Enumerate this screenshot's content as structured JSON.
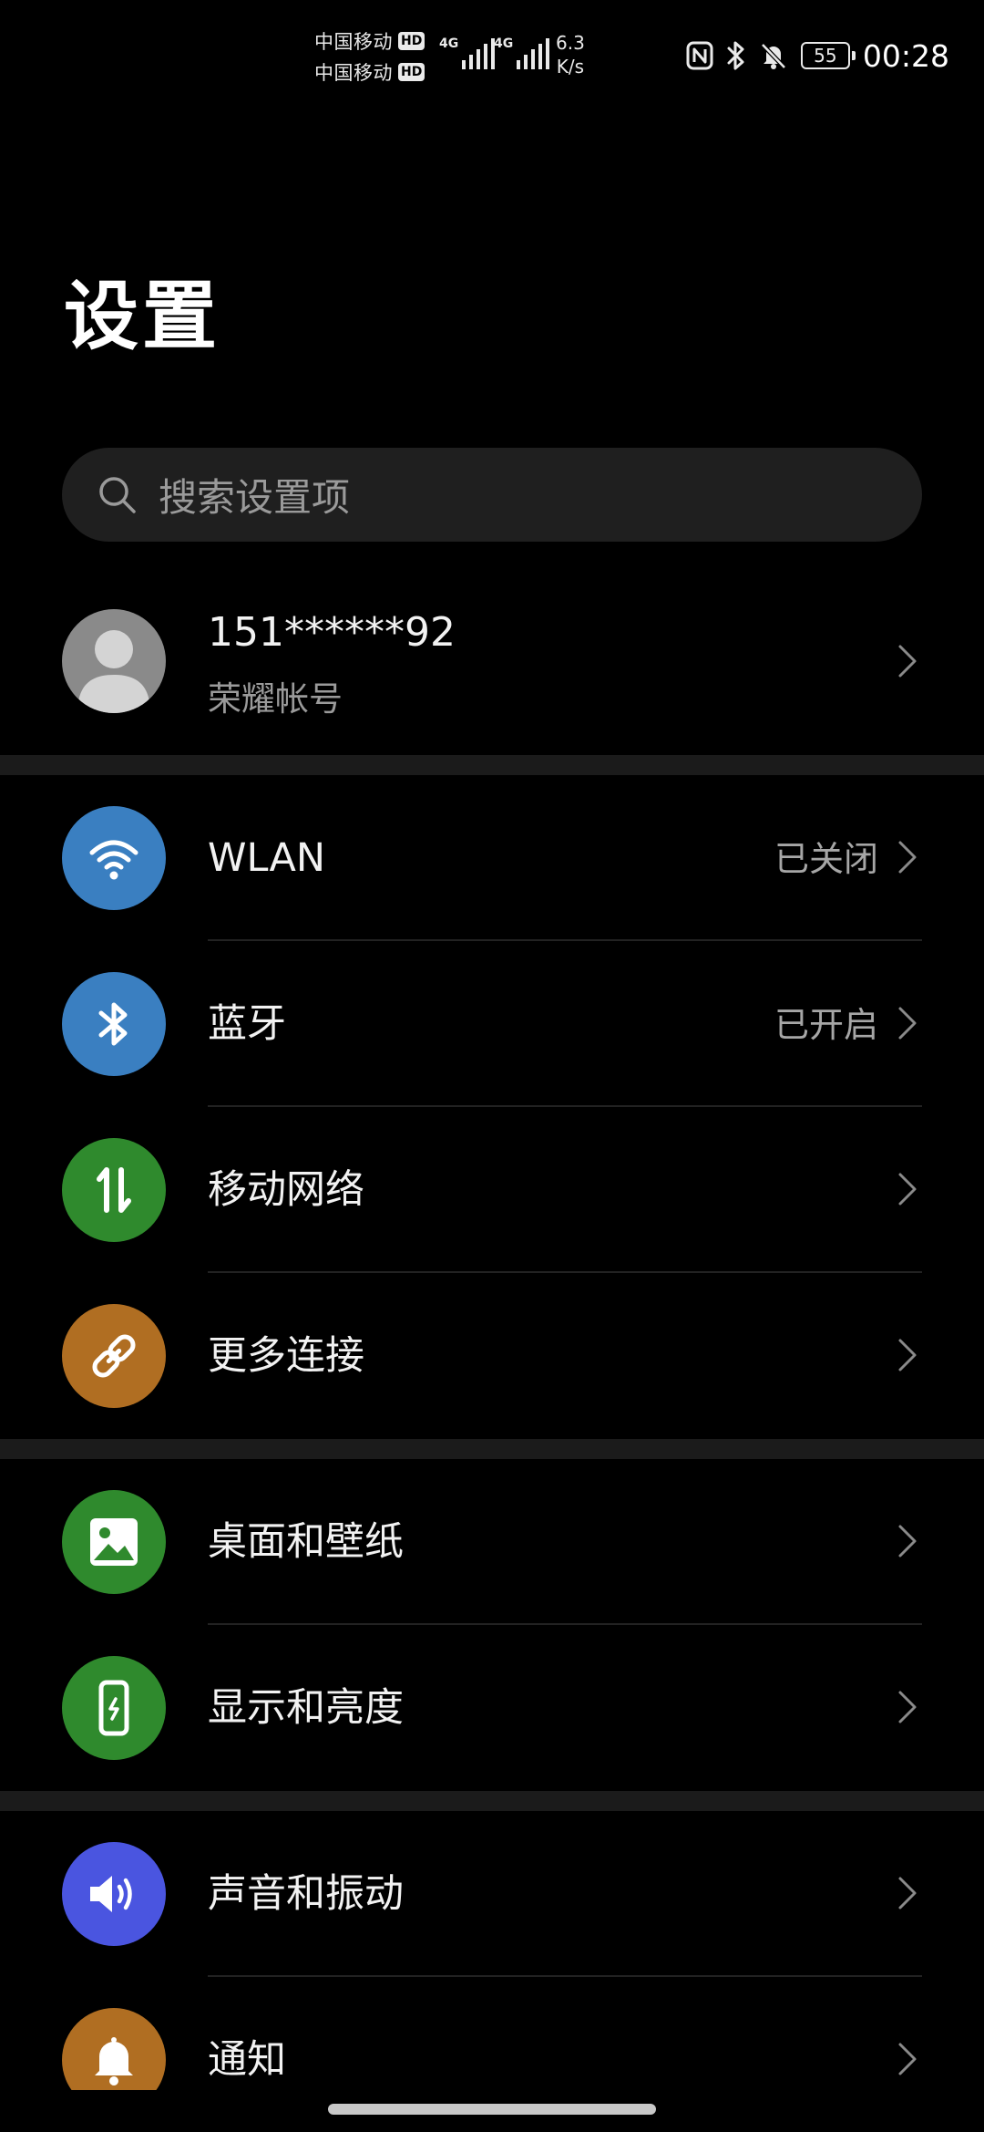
{
  "status_bar": {
    "carrier_1": "中国移动",
    "carrier_2": "中国移动",
    "hd_1": "HD",
    "hd_2": "HD",
    "network_1": "4G",
    "network_2": "4G",
    "speed_value": "6.3",
    "speed_unit": "K/s",
    "battery": "55",
    "time": "00:28",
    "icons": [
      "nfc-icon",
      "bluetooth-icon",
      "mute-icon",
      "battery-icon"
    ]
  },
  "header": {
    "title": "设置"
  },
  "search": {
    "placeholder": "搜索设置项"
  },
  "account": {
    "name": "151******92",
    "subtitle": "荣耀帐号"
  },
  "sections": [
    {
      "items": [
        {
          "label": "WLAN",
          "value": "已关闭",
          "icon": "wifi-icon",
          "color": "#3a7fc1"
        },
        {
          "label": "蓝牙",
          "value": "已开启",
          "icon": "bluetooth-icon",
          "color": "#3a7fc1"
        },
        {
          "label": "移动网络",
          "value": "",
          "icon": "mobile-data-icon",
          "color": "#2f8a2d"
        },
        {
          "label": "更多连接",
          "value": "",
          "icon": "link-icon",
          "color": "#b06e22"
        }
      ]
    },
    {
      "items": [
        {
          "label": "桌面和壁纸",
          "value": "",
          "icon": "wallpaper-icon",
          "color": "#2f8a2d"
        },
        {
          "label": "显示和亮度",
          "value": "",
          "icon": "display-icon",
          "color": "#2f8a2d"
        }
      ]
    },
    {
      "items": [
        {
          "label": "声音和振动",
          "value": "",
          "icon": "volume-icon",
          "color": "#4a55e0"
        },
        {
          "label": "通知",
          "value": "",
          "icon": "bell-icon",
          "color": "#b06e22"
        }
      ]
    }
  ]
}
